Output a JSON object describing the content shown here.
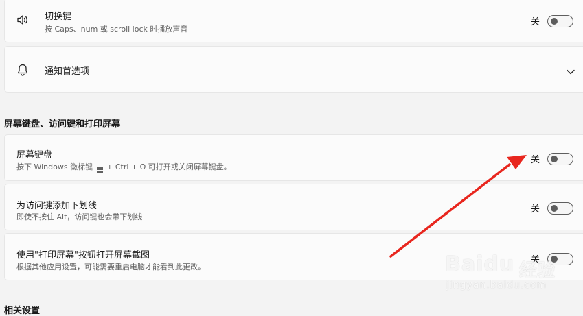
{
  "toggle_keys": {
    "title": "切换键",
    "description": "按 Caps、num 或 scroll lock 时播放声音",
    "state": "关",
    "icon": "speaker-icon",
    "on": false
  },
  "notifications": {
    "title": "通知首选项",
    "icon": "bell-icon",
    "expand_icon": "chevron-down-icon"
  },
  "section_header": "屏幕键盘、访问键和打印屏幕",
  "onscreen_keyboard": {
    "title": "屏幕键盘",
    "description_prefix": "按下 Windows 徽标键",
    "description_suffix": "+ Ctrl + O 可打开或关闭屏幕键盘。",
    "state": "关",
    "on": false
  },
  "access_keys": {
    "title": "为访问键添加下划线",
    "description": "即使不按住 Alt，访问键也会带下划线",
    "state": "关",
    "on": false
  },
  "print_screen": {
    "title": "使用\"打印屏幕\"按钮打开屏幕截图",
    "description": "根据其他应用设置，可能需要重启电脑才能看到此更改。",
    "state": "关",
    "on": false
  },
  "bottom_header": "相关设置",
  "watermark": {
    "logo": "Baidu",
    "chinese": "经验",
    "url": "jingyan.baidu.com"
  },
  "annotation_color": "#e8261e"
}
